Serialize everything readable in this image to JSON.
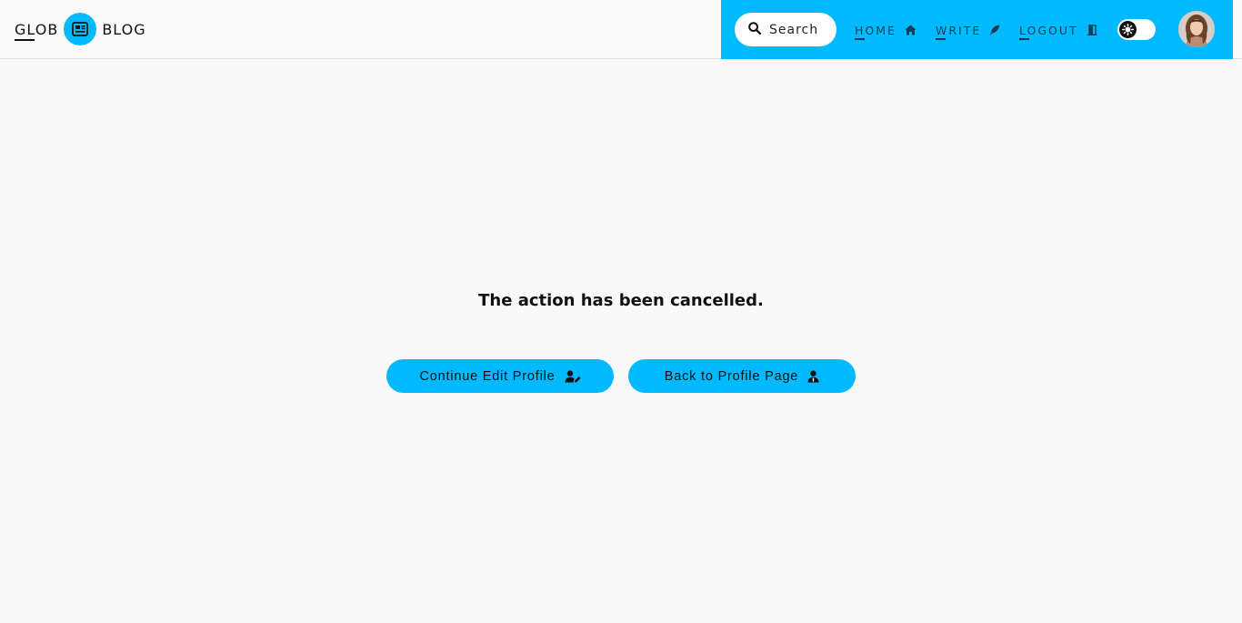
{
  "brand": {
    "left": "GLOB",
    "right": "BLOG",
    "logo_icon": "newspaper-icon"
  },
  "header": {
    "search": {
      "label": "Search",
      "icon": "search-icon"
    },
    "nav": [
      {
        "label": "HOME",
        "icon": "home-icon"
      },
      {
        "label": "WRITE",
        "icon": "feather-icon"
      },
      {
        "label": "LOGOUT",
        "icon": "door-exit-icon"
      }
    ],
    "theme_toggle": {
      "icon": "sun-gear-icon",
      "state": "dark-knob-left"
    },
    "avatar": {
      "icon": "user-avatar"
    }
  },
  "main": {
    "message": "The action has been cancelled.",
    "buttons": [
      {
        "label": "Continue Edit Profile",
        "icon": "user-edit-icon"
      },
      {
        "label": "Back to Profile Page",
        "icon": "user-tie-icon"
      }
    ]
  },
  "colors": {
    "accent": "#00b9ff",
    "background": "#f9f9f9",
    "nav_text": "#1d3a55",
    "text": "#111111"
  }
}
